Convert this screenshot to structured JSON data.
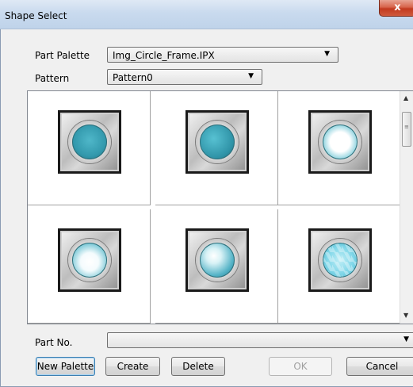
{
  "window": {
    "title": "Shape Select",
    "close_glyph": "x"
  },
  "form": {
    "part_palette_label": "Part Palette",
    "part_palette_value": "Img_Circle_Frame.IPX",
    "pattern_label": "Pattern",
    "pattern_value": "Pattern0",
    "part_no_label": "Part No.",
    "part_no_value": ""
  },
  "shapes": [
    {
      "name": "teal-dark"
    },
    {
      "name": "teal-glossy"
    },
    {
      "name": "white-center"
    },
    {
      "name": "white-glow"
    },
    {
      "name": "highlight-bubble"
    },
    {
      "name": "crystal"
    }
  ],
  "buttons": {
    "new_palette": "New Palette",
    "create": "Create",
    "delete": "Delete",
    "ok": "OK",
    "cancel": "Cancel"
  },
  "glyphs": {
    "dropdown": "▼",
    "scroll_up": "▲",
    "scroll_down": "▼",
    "grip": "≡"
  }
}
